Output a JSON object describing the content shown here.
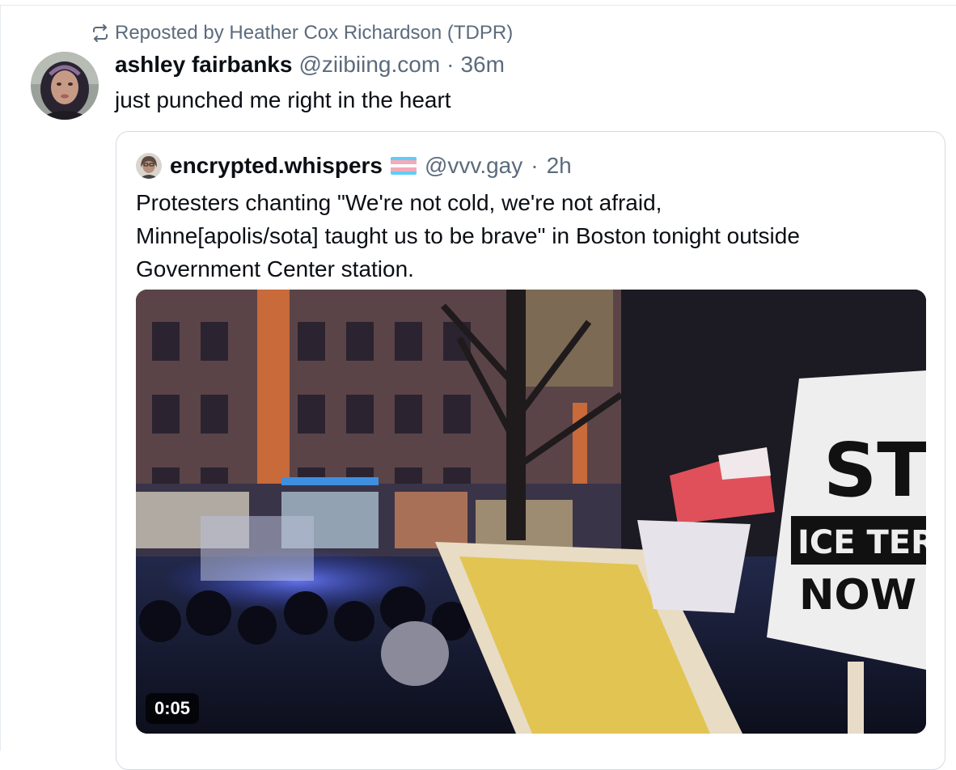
{
  "repost": {
    "icon": "repost-icon",
    "label": "Reposted by Heather Cox Richardson (TDPR)"
  },
  "post": {
    "display_name": "ashley fairbanks",
    "handle": "@ziibiing.com",
    "separator": "·",
    "time": "36m",
    "text": "just punched me right in the heart"
  },
  "quote": {
    "display_name": "encrypted.whispers",
    "flag_icon": "trans-flag-icon",
    "handle": "@vvv.gay",
    "separator": "·",
    "time": "2h",
    "text_lines": [
      "Protesters chanting \"We're not cold, we're not afraid,",
      "Minne[apolis/sota] taught us to be brave\" in Boston tonight outside",
      "Government Center station."
    ],
    "video": {
      "duration": "0:05"
    }
  },
  "colors": {
    "text_primary": "#0b0f14",
    "text_secondary": "#5b6b7c",
    "border": "#d4dbe3",
    "flag_blue": "#5bcefa",
    "flag_pink": "#f5a9b8",
    "flag_white": "#ffffff"
  }
}
